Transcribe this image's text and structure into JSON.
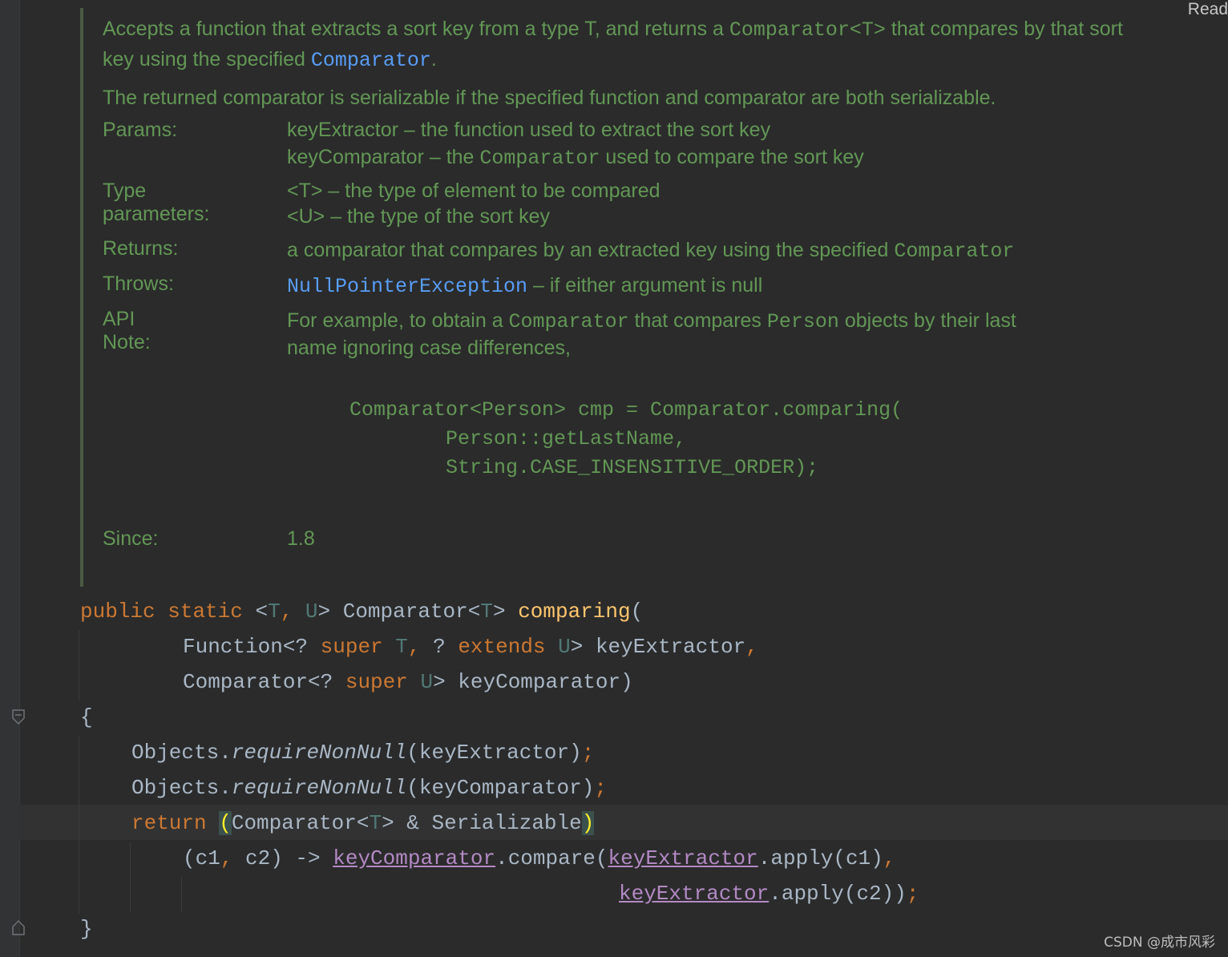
{
  "reader_mode_label": "Read",
  "doc": {
    "desc_a": "Accepts a function that extracts a sort key from a type T, and returns a ",
    "desc_a_code": "Comparator<T>",
    "desc_a2": " that compares by that sort key using the specified ",
    "desc_a_link": "Comparator",
    "desc_a3": ".",
    "desc_b": "The returned comparator is serializable if the specified function and comparator are both serializable.",
    "params_label": "Params:",
    "param1": "keyExtractor – the function used to extract the sort key",
    "param2_a": "keyComparator – the ",
    "param2_code": "Comparator",
    "param2_b": " used to compare the sort key",
    "type_params_label": "Type parameters:",
    "tparam1": "<T> – the type of element to be compared",
    "tparam2": "<U> – the type of the sort key",
    "returns_label": "Returns:",
    "returns_a": "a comparator that compares by an extracted key using the specified ",
    "returns_code": "Comparator",
    "throws_label": "Throws:",
    "throws_link": "NullPointerException",
    "throws_b": " – if either argument is null",
    "apinote_label": "API Note:",
    "apinote_a": "For example, to obtain a ",
    "apinote_code1": "Comparator",
    "apinote_b": " that compares ",
    "apinote_code2": "Person",
    "apinote_c": " objects by their last",
    "apinote_d": "name ignoring case differences,",
    "example_line1": "Comparator<Person> cmp = Comparator.comparing(",
    "example_line2": "        Person::getLastName,",
    "example_line3": "        String.CASE_INSENSITIVE_ORDER);",
    "since_label": "Since:",
    "since_value": "1.8"
  },
  "code": {
    "sig_public": "public",
    "sig_static": "static",
    "sig_lt": " <",
    "sig_T": "T",
    "sig_comma": ", ",
    "sig_U": "U",
    "sig_gt": "> Comparator<",
    "sig_T2": "T",
    "sig_gt2": "> ",
    "sig_name": "comparing",
    "sig_paren": "(",
    "p1_a": "Function<? ",
    "p1_super": "super",
    "p1_T": "T",
    "p1_comma": ", ",
    "p1_q": "? ",
    "p1_extends": "extends",
    "p1_U": "U",
    "p1_b": "> keyExtractor",
    "p1_c": ",",
    "p2_a": "Comparator<? ",
    "p2_super": "super",
    "p2_U": "U",
    "p2_b": "> keyComparator)",
    "open_brace": "{",
    "l1_a": "Objects.",
    "l1_m": "requireNonNull",
    "l1_b": "(keyExtractor)",
    "l1_semi": ";",
    "l2_a": "Objects.",
    "l2_m": "requireNonNull",
    "l2_b": "(keyComparator)",
    "l2_semi": ";",
    "l3_return": "return",
    "l3_open": "(",
    "l3_a": "Comparator<",
    "l3_T": "T",
    "l3_b": "> & Serializable",
    "l3_close": ")",
    "l4_a": "(c1",
    "l4_comma": ",",
    "l4_b": " c2) -> ",
    "l4_field1": "keyComparator",
    "l4_c": ".compare(",
    "l4_field2": "keyExtractor",
    "l4_d": ".apply(c1)",
    "l4_comma2": ",",
    "l5_field": "keyExtractor",
    "l5_a": ".apply(c2))",
    "l5_semi": ";",
    "close_brace": "}"
  },
  "watermark": "CSDN @成市风彩"
}
